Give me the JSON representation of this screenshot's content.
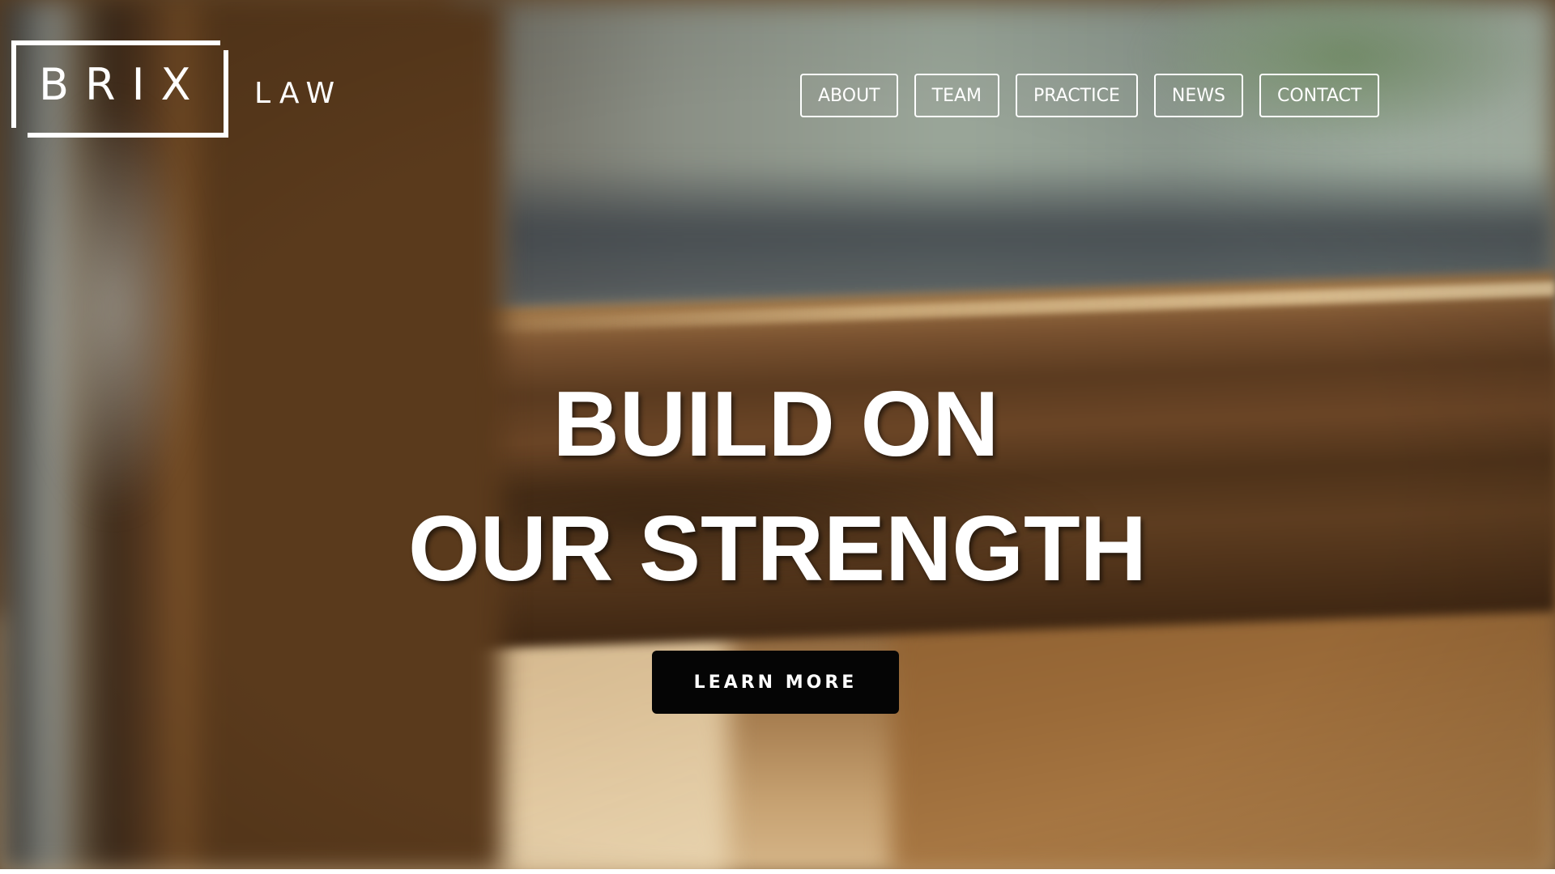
{
  "logo": {
    "brand": "BRIX",
    "suffix": "LAW"
  },
  "nav": {
    "items": [
      {
        "label": "ABOUT"
      },
      {
        "label": "TEAM"
      },
      {
        "label": "PRACTICE"
      },
      {
        "label": "NEWS"
      },
      {
        "label": "CONTACT"
      }
    ]
  },
  "hero": {
    "headline_line1": "BUILD ON",
    "headline_line2": "OUR STRENGTH",
    "cta_label": "LEARN MORE"
  },
  "colors": {
    "text": "#ffffff",
    "cta_background": "#050505",
    "nav_border": "#ffffff"
  }
}
